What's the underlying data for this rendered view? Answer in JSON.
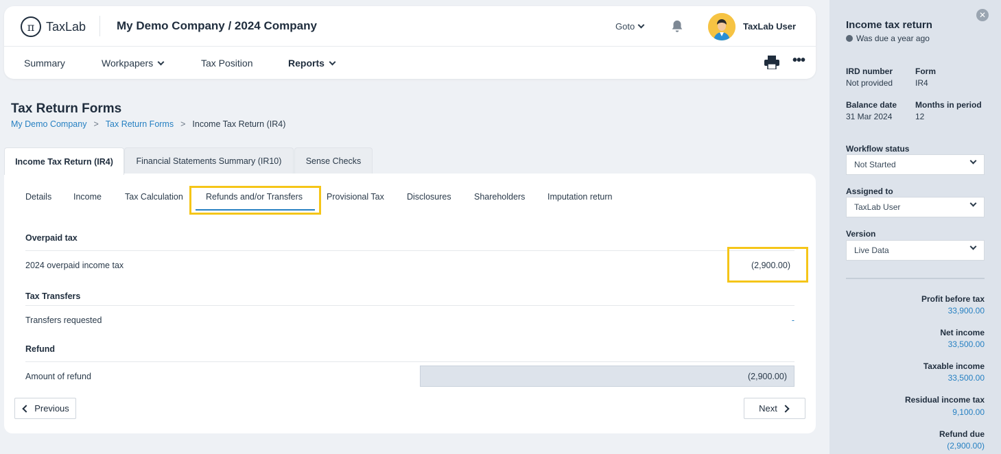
{
  "header": {
    "logo_mark": "π",
    "logo_text": "TaxLab",
    "company_title": "My Demo Company / 2024 Company",
    "goto_label": "Goto",
    "user_name": "TaxLab User"
  },
  "nav": {
    "summary": "Summary",
    "workpapers": "Workpapers",
    "tax_position": "Tax Position",
    "reports": "Reports",
    "more": "•••"
  },
  "page": {
    "title": "Tax Return Forms",
    "breadcrumb": [
      "My Demo Company",
      "Tax Return Forms",
      "Income Tax Return (IR4)"
    ],
    "breadcrumb_sep": ">"
  },
  "main_tabs": [
    "Income Tax Return (IR4)",
    "Financial Statements Summary (IR10)",
    "Sense Checks"
  ],
  "sub_tabs": [
    "Details",
    "Income",
    "Tax Calculation",
    "Refunds and/or Transfers",
    "Provisional Tax",
    "Disclosures",
    "Shareholders",
    "Imputation return"
  ],
  "sections": {
    "overpaid": {
      "title": "Overpaid tax",
      "label": "2024 overpaid income tax",
      "value": "(2,900.00)"
    },
    "transfers": {
      "title": "Tax Transfers",
      "label": "Transfers requested",
      "value": "-"
    },
    "refund": {
      "title": "Refund",
      "label": "Amount of refund",
      "value": "(2,900.00)"
    }
  },
  "buttons": {
    "previous": "Previous",
    "next": "Next"
  },
  "panel": {
    "close": "✕",
    "title": "Income tax return",
    "due": "Was due a year ago",
    "ird_label": "IRD number",
    "ird_value": "Not provided",
    "form_label": "Form",
    "form_value": "IR4",
    "balance_label": "Balance date",
    "balance_value": "31 Mar 2024",
    "months_label": "Months in period",
    "months_value": "12",
    "workflow_label": "Workflow status",
    "workflow_value": "Not Started",
    "assigned_label": "Assigned to",
    "assigned_value": "TaxLab User",
    "version_label": "Version",
    "version_value": "Live Data",
    "summary": [
      {
        "label": "Profit before tax",
        "value": "33,900.00"
      },
      {
        "label": "Net income",
        "value": "33,500.00"
      },
      {
        "label": "Taxable income",
        "value": "33,500.00"
      },
      {
        "label": "Residual income tax",
        "value": "9,100.00"
      },
      {
        "label": "Refund due",
        "value": "(2,900.00)"
      }
    ]
  },
  "colors": {
    "accent_blue": "#2680c2",
    "highlight_yellow": "#f5c518",
    "avatar_yellow": "#f6c343"
  }
}
